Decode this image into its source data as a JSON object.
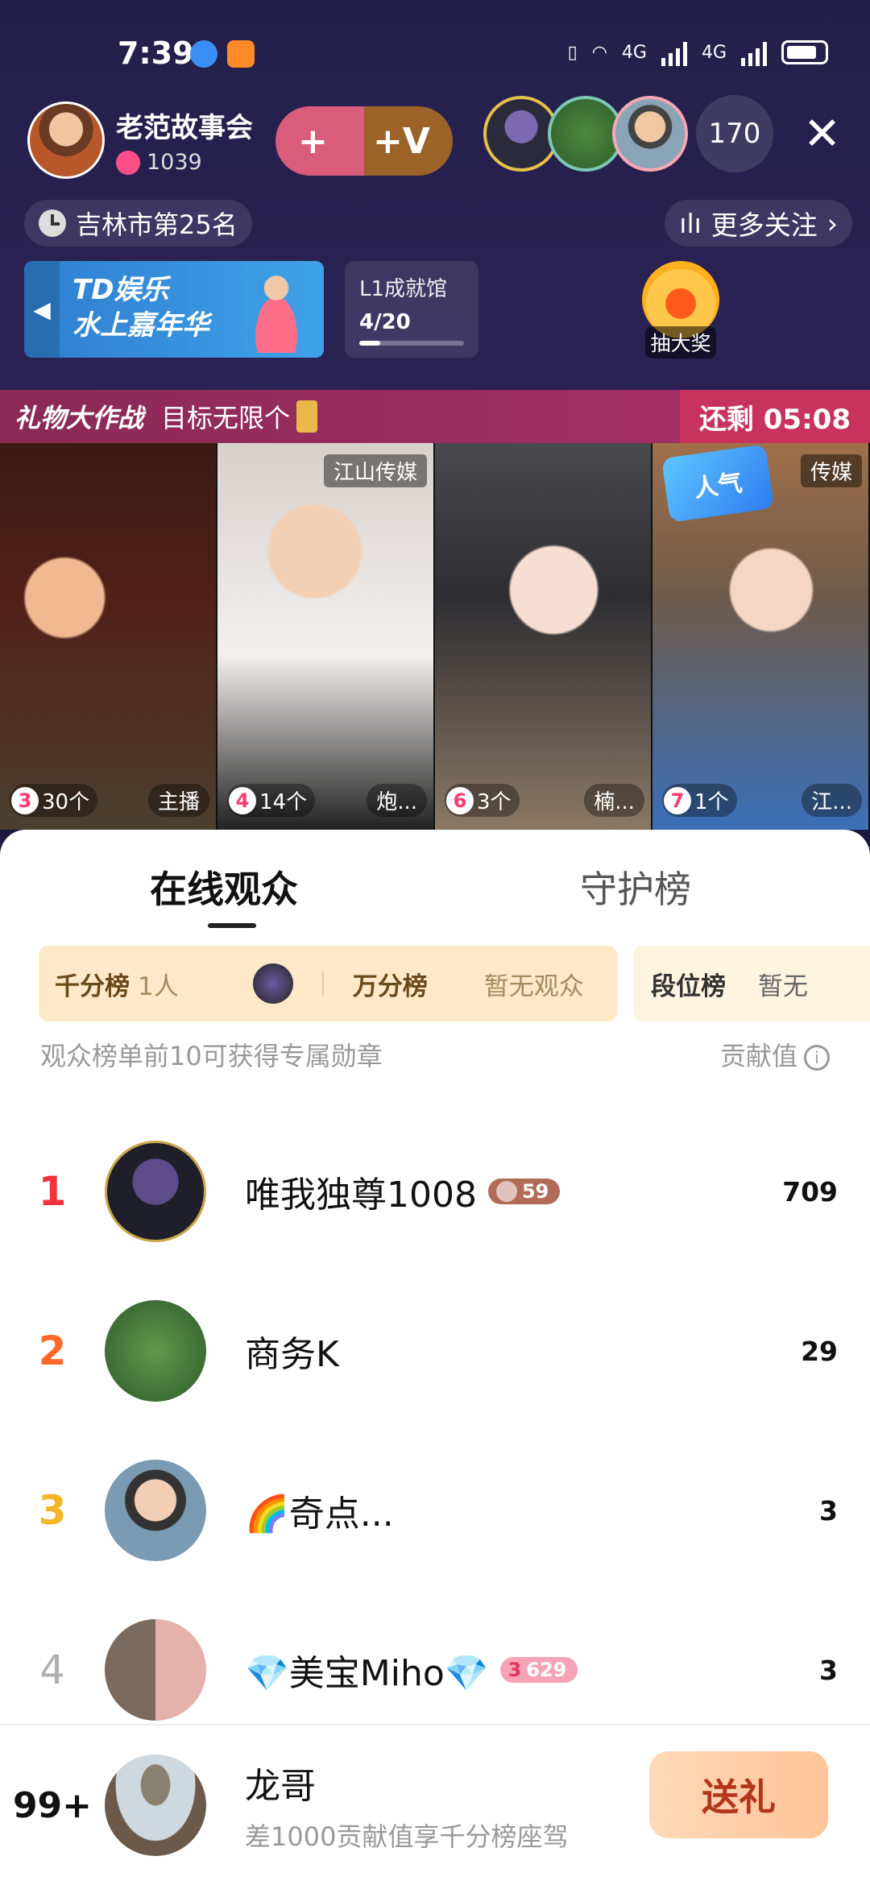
{
  "status_bar": {
    "time": "7:39",
    "signal": "4G"
  },
  "host": {
    "name": "老范故事会",
    "fans": "1039"
  },
  "follow": {
    "plus": "+",
    "v_label": "+V"
  },
  "viewers": {
    "count": "170"
  },
  "city_rank": "吉林市第25名",
  "more_follow": "更多关注",
  "promo": {
    "line1": "TD娱乐",
    "line2": "水上嘉年华"
  },
  "achievement": {
    "title": "L1成就馆",
    "progress": "4/20",
    "fraction": 0.2
  },
  "lottery": {
    "label": "抽大奖"
  },
  "gift_battle": {
    "title": "礼物大作战",
    "goal": "目标无限个",
    "timer": "还剩 05:08"
  },
  "tiles": [
    {
      "rank": "3",
      "count": "30个",
      "name": "主播",
      "tag": ""
    },
    {
      "rank": "4",
      "count": "14个",
      "name": "炮...",
      "tag": "江山传媒"
    },
    {
      "rank": "6",
      "count": "3个",
      "name": "楠...",
      "tag": ""
    },
    {
      "rank": "7",
      "count": "1个",
      "name": "江...",
      "tag": "传媒"
    }
  ],
  "popularity_badge": "人气",
  "tabs": {
    "online": "在线观众",
    "guard": "守护榜"
  },
  "ranks_bar": {
    "thousand_label": "千分榜",
    "thousand_val": "1人",
    "tenthousand_label": "万分榜",
    "tenthousand_val": "暂无观众",
    "segment_label": "段位榜",
    "segment_val": "暂无"
  },
  "hint": {
    "left": "观众榜单前10可获得专属勋章",
    "right": "贡献值"
  },
  "list": [
    {
      "rank": "1",
      "name": "唯我独尊1008",
      "badge": "59",
      "score": "709"
    },
    {
      "rank": "2",
      "name": "商务K",
      "badge": "",
      "score": "29"
    },
    {
      "rank": "3",
      "name": "🌈奇点...",
      "badge": "",
      "score": "3"
    },
    {
      "rank": "4",
      "name": "💎美宝Miho💎",
      "badge": "629",
      "badge_level": "3",
      "score": "3"
    }
  ],
  "footer": {
    "rank": "99+",
    "name": "龙哥",
    "hint": "差1000贡献值享千分榜座驾",
    "button": "送礼"
  },
  "colors": {
    "rank1": "#f0333c",
    "rank2": "#ff6a2a",
    "rank3": "#f4b528",
    "rank4": "#b0b0b0"
  }
}
